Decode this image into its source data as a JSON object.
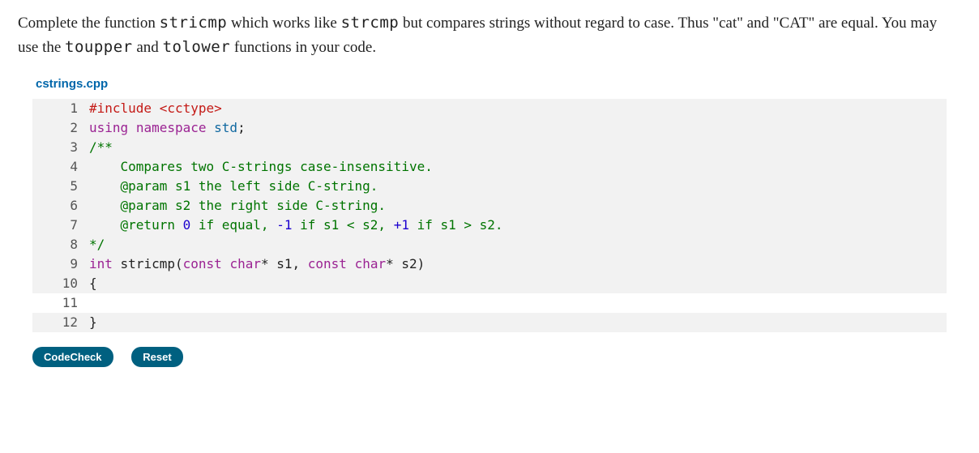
{
  "problem": {
    "segments": [
      {
        "t": "Complete the function "
      },
      {
        "t": "stricmp",
        "mono": true
      },
      {
        "t": " which works like "
      },
      {
        "t": "strcmp",
        "mono": true
      },
      {
        "t": " but compares strings without regard to case. Thus \"cat\" and \"CAT\" are equal. You may use the "
      },
      {
        "t": "toupper",
        "mono": true
      },
      {
        "t": " and "
      },
      {
        "t": "tolower",
        "mono": true
      },
      {
        "t": " functions in your code."
      }
    ]
  },
  "filename": "cstrings.cpp",
  "code_lines": [
    {
      "n": 1,
      "tokens": [
        {
          "t": "#include ",
          "c": "pre"
        },
        {
          "t": "<cctype>",
          "c": "type"
        }
      ]
    },
    {
      "n": 2,
      "tokens": [
        {
          "t": "using",
          "c": "kw"
        },
        {
          "t": " "
        },
        {
          "t": "namespace",
          "c": "kw"
        },
        {
          "t": " "
        },
        {
          "t": "std",
          "c": "ns"
        },
        {
          "t": ";"
        }
      ]
    },
    {
      "n": 3,
      "tokens": [
        {
          "t": "/**",
          "c": "cm"
        }
      ]
    },
    {
      "n": 4,
      "tokens": [
        {
          "t": "    Compares two C-strings case-insensitive.",
          "c": "cm"
        }
      ]
    },
    {
      "n": 5,
      "tokens": [
        {
          "t": "    @param s1 the left side C-string.",
          "c": "cm"
        }
      ]
    },
    {
      "n": 6,
      "tokens": [
        {
          "t": "    @param s2 the right side C-string.",
          "c": "cm"
        }
      ]
    },
    {
      "n": 7,
      "tokens": [
        {
          "t": "    @return ",
          "c": "cm"
        },
        {
          "t": "0",
          "c": "num"
        },
        {
          "t": " if equal, ",
          "c": "cm"
        },
        {
          "t": "-1",
          "c": "num"
        },
        {
          "t": " if s1 < s2, ",
          "c": "cm"
        },
        {
          "t": "+1",
          "c": "num"
        },
        {
          "t": " if s1 > s2.",
          "c": "cm"
        }
      ]
    },
    {
      "n": 8,
      "tokens": [
        {
          "t": "*/",
          "c": "cm"
        }
      ]
    },
    {
      "n": 9,
      "tokens": [
        {
          "t": "int",
          "c": "kw"
        },
        {
          "t": " "
        },
        {
          "t": "stricmp",
          "c": "fn"
        },
        {
          "t": "("
        },
        {
          "t": "const",
          "c": "kw"
        },
        {
          "t": " "
        },
        {
          "t": "char",
          "c": "kw"
        },
        {
          "t": "* s1, "
        },
        {
          "t": "const",
          "c": "kw"
        },
        {
          "t": " "
        },
        {
          "t": "char",
          "c": "kw"
        },
        {
          "t": "* s2)"
        }
      ]
    },
    {
      "n": 10,
      "tokens": [
        {
          "t": "{"
        }
      ]
    },
    {
      "n": 11,
      "active": true,
      "tokens": [
        {
          "t": ""
        }
      ]
    },
    {
      "n": 12,
      "tokens": [
        {
          "t": "}"
        }
      ]
    }
  ],
  "buttons": {
    "codecheck": "CodeCheck",
    "reset": "Reset"
  }
}
